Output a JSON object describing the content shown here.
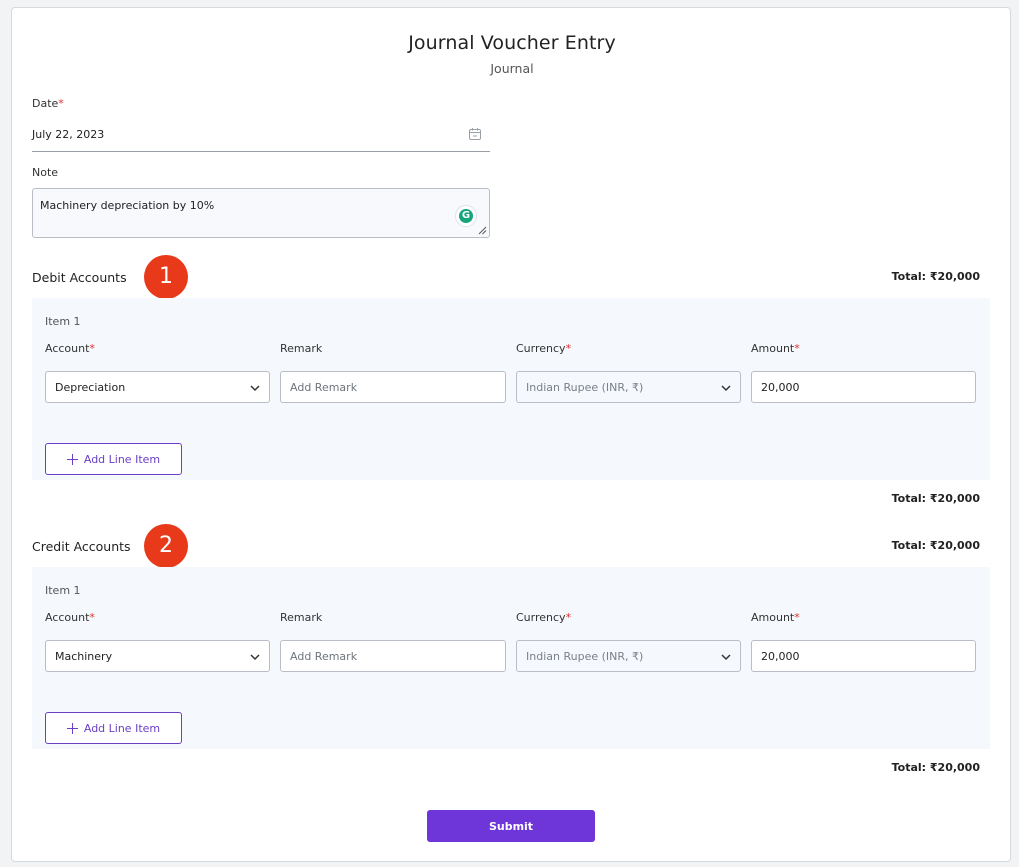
{
  "header": {
    "title": "Journal Voucher Entry",
    "subtitle": "Journal"
  },
  "date": {
    "label": "Date",
    "required": "*",
    "value": "July 22, 2023"
  },
  "note": {
    "label": "Note",
    "value": "Machinery depreciation by 10%"
  },
  "debit": {
    "title": "Debit Accounts",
    "badge": "1",
    "total_top": "Total: ₹20,000",
    "total_bottom": "Total: ₹20,000",
    "item_label": "Item 1",
    "labels": {
      "account": "Account",
      "remark": "Remark",
      "currency": "Currency",
      "amount": "Amount",
      "required": "*"
    },
    "account": "Depreciation",
    "remark_placeholder": "Add Remark",
    "currency": "Indian Rupee (INR, ₹)",
    "amount": "20,000",
    "add_line_label": "Add Line Item"
  },
  "credit": {
    "title": "Credit Accounts",
    "badge": "2",
    "total_top": "Total: ₹20,000",
    "total_bottom": "Total: ₹20,000",
    "item_label": "Item 1",
    "labels": {
      "account": "Account",
      "remark": "Remark",
      "currency": "Currency",
      "amount": "Amount",
      "required": "*"
    },
    "account": "Machinery",
    "remark_placeholder": "Add Remark",
    "currency": "Indian Rupee (INR, ₹)",
    "amount": "20,000",
    "add_line_label": "Add Line Item"
  },
  "submit_label": "Submit",
  "colors": {
    "accent": "#6e36d8",
    "badge": "#e8391a",
    "required": "#e0312f",
    "grammarly": "#15a67a"
  },
  "icons": [
    "calendar-icon",
    "grammarly-icon",
    "resize-handle-icon",
    "chevron-down-icon",
    "plus-icon"
  ]
}
